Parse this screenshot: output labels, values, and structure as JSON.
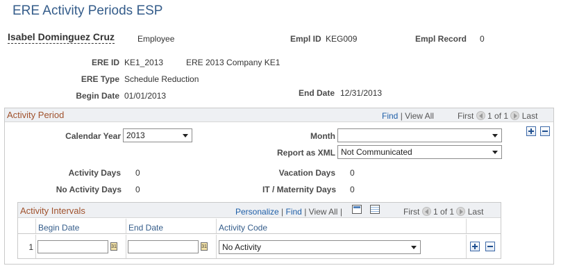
{
  "page": {
    "title": "ERE Activity Periods ESP"
  },
  "employee": {
    "name": "Isabel Dominguez Cruz",
    "type": "Employee",
    "empl_id_label": "Empl ID",
    "empl_id": "KEG009",
    "empl_record_label": "Empl Record",
    "empl_record": "0"
  },
  "ere": {
    "id_label": "ERE ID",
    "id": "KE1_2013",
    "description": "ERE 2013 Company KE1",
    "type_label": "ERE Type",
    "type": "Schedule Reduction",
    "begin_label": "Begin Date",
    "begin": "01/01/2013",
    "end_label": "End Date",
    "end": "12/31/2013"
  },
  "activity_period": {
    "title": "Activity Period",
    "find": "Find",
    "sep": "|",
    "view_all": "View All",
    "first": "First",
    "range": "1 of 1",
    "last": "Last",
    "calendar_year_label": "Calendar Year",
    "calendar_year": "2013",
    "month_label": "Month",
    "month": "",
    "report_xml_label": "Report as XML",
    "report_xml": "Not Communicated",
    "activity_days_label": "Activity Days",
    "activity_days": "0",
    "no_activity_days_label": "No Activity Days",
    "no_activity_days": "0",
    "vacation_days_label": "Vacation Days",
    "vacation_days": "0",
    "it_maternity_days_label": "IT / Maternity Days",
    "it_maternity_days": "0"
  },
  "activity_intervals": {
    "title": "Activity Intervals",
    "personalize": "Personalize",
    "find": "Find",
    "view_all": "View All",
    "first": "First",
    "range": "1 of 1",
    "last": "Last",
    "columns": [
      "Begin Date",
      "End Date",
      "Activity Code"
    ],
    "rows": [
      {
        "num": "1",
        "begin": "",
        "end": "",
        "activity_code": "No Activity"
      }
    ]
  },
  "icons": {
    "calendar": "calendar-icon",
    "add": "add-row-icon",
    "delete": "delete-row-icon",
    "zoom": "new-window-icon",
    "grid": "download-grid-icon",
    "prev": "prev-arrow-icon",
    "next": "next-arrow-icon"
  },
  "colors": {
    "title": "#345c8a",
    "section_title": "#a0522d",
    "link": "#1f5fa8"
  }
}
